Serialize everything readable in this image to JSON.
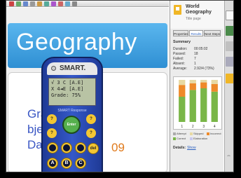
{
  "slide": {
    "title": "Geography",
    "lines": [
      "Grade",
      "bject",
      "Dat"
    ],
    "year": "09"
  },
  "remote": {
    "logo": "SMART.",
    "screen_lines": [
      "√ 3 C    [A.E]",
      "X 4◄E   [A.E]",
      "Grade:  75%"
    ],
    "label": "SMART Response",
    "buttons": {
      "up": "?",
      "down": "?",
      "left": "?",
      "right": "?",
      "enter": "Enter",
      "del": "del"
    },
    "keys": [
      "A",
      "B",
      "C"
    ]
  },
  "panel": {
    "title": "World Geography",
    "subtitle": "Title page",
    "tabs": [
      "Properties",
      "Results",
      "Next Steps"
    ],
    "active_tab": "Results",
    "summary_title": "Summary",
    "summary": [
      {
        "label": "Duration:",
        "value": "00:05:02"
      },
      {
        "label": "Passed:",
        "value": "18"
      },
      {
        "label": "Failed:",
        "value": "7"
      },
      {
        "label": "Absent:",
        "value": "1"
      },
      {
        "label": "Average:",
        "value": "2.92/4 (73%)"
      }
    ],
    "legend": [
      "Attempt",
      "Skipped",
      "Incorrect",
      "Correct",
      "Elaboration"
    ],
    "details_label": "Details:",
    "details_link": "Show"
  },
  "chart_data": {
    "type": "bar",
    "categories": [
      "1",
      "2",
      "3",
      "4"
    ],
    "series": [
      {
        "name": "Correct",
        "color": "#7ab648",
        "values": [
          60,
          76,
          80,
          72
        ]
      },
      {
        "name": "Incorrect",
        "color": "#ee8a2a",
        "values": [
          28,
          16,
          14,
          18
        ]
      },
      {
        "name": "Skipped",
        "color": "#e7d9a3",
        "values": [
          12,
          8,
          6,
          10
        ]
      }
    ],
    "ylim": [
      0,
      100
    ],
    "legend_position": "bottom",
    "grid": false
  },
  "colors": {
    "title_bar": "#2f8fd3",
    "remote_body": "#3458c8",
    "key_yellow": "#f3c633"
  }
}
